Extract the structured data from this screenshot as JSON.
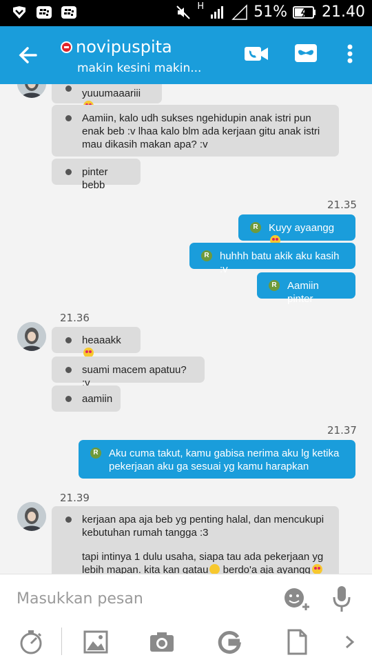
{
  "status_bar": {
    "battery": "51%",
    "time": "21.40",
    "network": "H"
  },
  "header": {
    "contact_name": "novipuspita",
    "contact_status": "makin kesini makin..."
  },
  "messages": [
    {
      "id": "m1",
      "text": "yuuumaaariii"
    },
    {
      "id": "m2",
      "text": "Aamiin, kalo udh sukses ngehidupin anak istri pun enak beb :v lhaa kalo blm ada kerjaan gitu anak istri mau dikasih makan apa? :v"
    },
    {
      "id": "m3",
      "text": "pinter bebb"
    },
    {
      "id": "t1",
      "text": "21.35"
    },
    {
      "id": "m4",
      "text": "Kuyy ayaangg"
    },
    {
      "id": "m5",
      "text": "huhhh batu akik aku kasih :v"
    },
    {
      "id": "m6",
      "text": "Aamiin pinter"
    },
    {
      "id": "t2",
      "text": "21.36"
    },
    {
      "id": "m7",
      "text": "heaaakk"
    },
    {
      "id": "m8",
      "text": "suami macem apatuu? :v"
    },
    {
      "id": "m9",
      "text": "aamiin"
    },
    {
      "id": "t3",
      "text": "21.37"
    },
    {
      "id": "m10",
      "text": "Aku cuma takut, kamu gabisa nerima aku lg ketika pekerjaan aku ga sesuai yg kamu harapkan"
    },
    {
      "id": "t4",
      "text": "21.39"
    },
    {
      "id": "m11a",
      "text": "kerjaan apa aja beb yg penting halal, dan mencukupi kebutuhan rumah tangga :3"
    },
    {
      "id": "m11b",
      "text": "tapi intinya 1 dulu usaha, siapa tau ada pekerjaan yg lebih mapan. kita kan gatau"
    },
    {
      "id": "m11c",
      "text": "berdo'a aja ayangg"
    }
  ],
  "read_mark": "R",
  "input": {
    "placeholder": "Masukkan pesan"
  },
  "colors": {
    "accent": "#1a9ddb",
    "incoming_bubble": "#dcdcdc",
    "read_mark": "#6e9a3c"
  },
  "icons": [
    "back-arrow-icon",
    "busy-status-icon",
    "video-call-icon",
    "mask-icon",
    "more-vert-icon",
    "emoji-add-icon",
    "microphone-icon",
    "stopwatch-icon",
    "image-icon",
    "camera-icon",
    "refresh-g-icon",
    "file-icon",
    "chevron-right-icon"
  ]
}
